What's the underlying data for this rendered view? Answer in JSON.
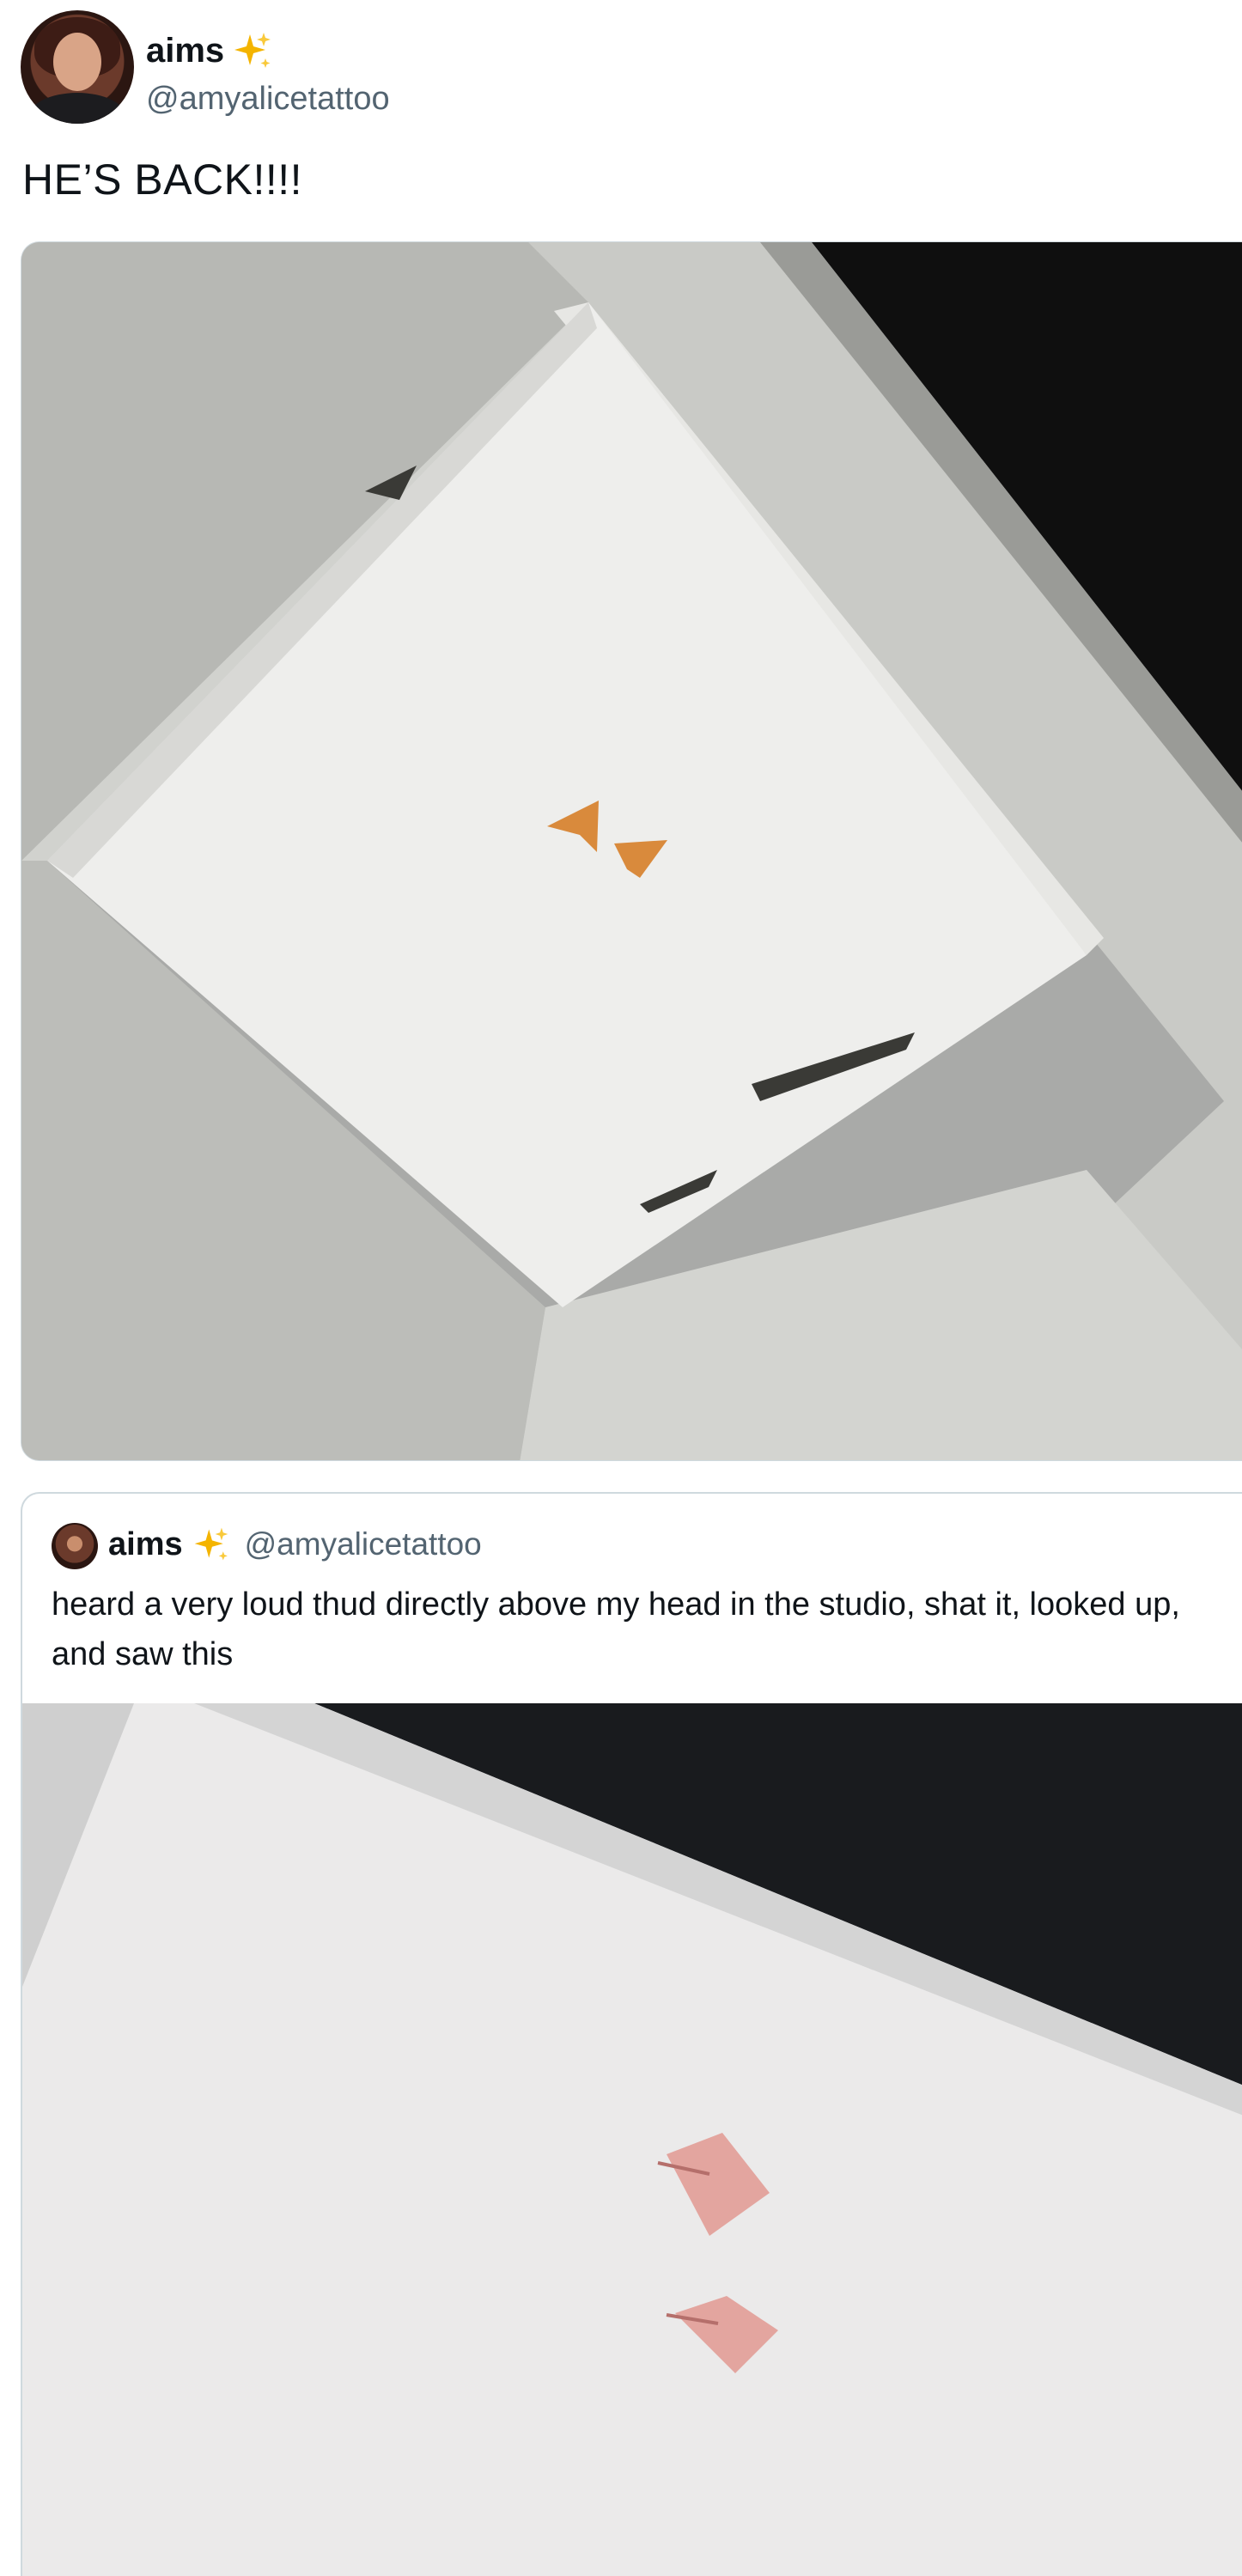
{
  "tweet": {
    "author": {
      "display_name": "aims",
      "handle": "@amyalicetattoo",
      "badge_icon": "sparkles-icon"
    },
    "text": "HE’S BACK!!!!",
    "media": {
      "description_icon": "skylight-photo"
    }
  },
  "quoted_tweet": {
    "author": {
      "display_name": "aims",
      "handle": "@amyalicetattoo",
      "badge_icon": "sparkles-icon"
    },
    "text": "heard a very loud thud directly above my head in the studio, shat it, looked up, and saw this",
    "media": {
      "description_icon": "duck-feet-photo"
    }
  },
  "colors": {
    "text": "#0f1419",
    "secondary": "#536471",
    "border": "#cfd9de",
    "sparkle": "#f4b400"
  }
}
